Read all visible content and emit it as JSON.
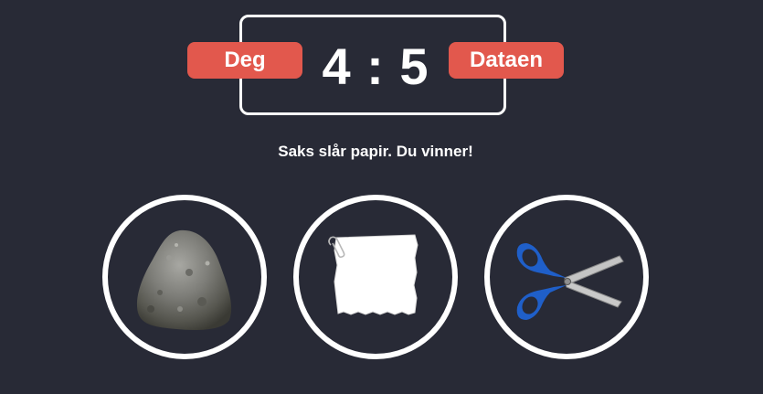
{
  "scoreboard": {
    "user_label": "Deg",
    "computer_label": "Dataen",
    "user_score": "4",
    "separator": ":",
    "computer_score": "5"
  },
  "result_message": "Saks slår papir. Du vinner!",
  "choices": [
    {
      "id": "rock",
      "icon": "rock-icon"
    },
    {
      "id": "paper",
      "icon": "paper-icon"
    },
    {
      "id": "scissors",
      "icon": "scissors-icon"
    }
  ],
  "colors": {
    "background": "#282a36",
    "badge": "#e2584d",
    "border": "#ffffff",
    "scissors_handle": "#1f5fc9"
  }
}
